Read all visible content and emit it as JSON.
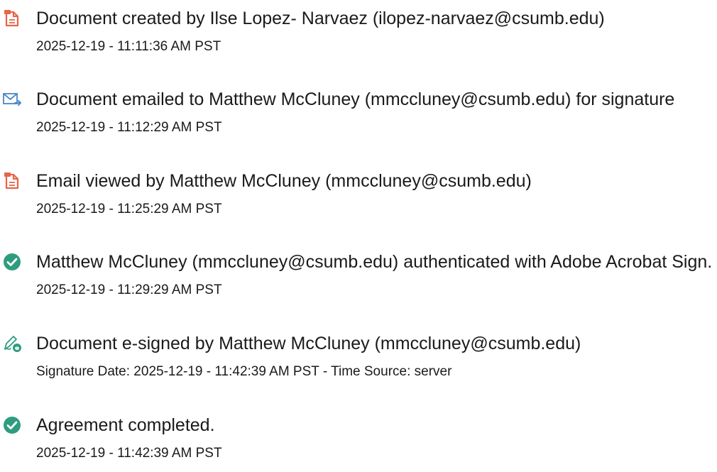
{
  "events": [
    {
      "icon": "document-icon",
      "title": "Document created by Ilse Lopez- Narvaez (ilopez-narvaez@csumb.edu)",
      "detail": "2025-12-19 - 11:11:36 AM PST"
    },
    {
      "icon": "email-sent-icon",
      "title": "Document emailed to Matthew McCluney (mmccluney@csumb.edu) for signature",
      "detail": "2025-12-19 - 11:12:29 AM PST"
    },
    {
      "icon": "document-icon",
      "title": "Email viewed by Matthew McCluney (mmccluney@csumb.edu)",
      "detail": "2025-12-19 - 11:25:29 AM PST"
    },
    {
      "icon": "check-circle-icon",
      "title": "Matthew McCluney (mmccluney@csumb.edu) authenticated with Adobe Acrobat Sign.",
      "detail": "2025-12-19 - 11:29:29 AM PST"
    },
    {
      "icon": "e-sign-pen-icon",
      "title": "Document e-signed by Matthew McCluney (mmccluney@csumb.edu)",
      "detail": "Signature Date: 2025-12-19 - 11:42:39 AM PST - Time Source: server"
    },
    {
      "icon": "check-circle-icon",
      "title": "Agreement completed.",
      "detail": "2025-12-19 - 11:42:39 AM PST"
    }
  ],
  "colors": {
    "document_icon": "#e8644a",
    "email_icon": "#4a86c7",
    "check_icon": "#2e9c7f",
    "esign_icon": "#2e9c7f"
  }
}
